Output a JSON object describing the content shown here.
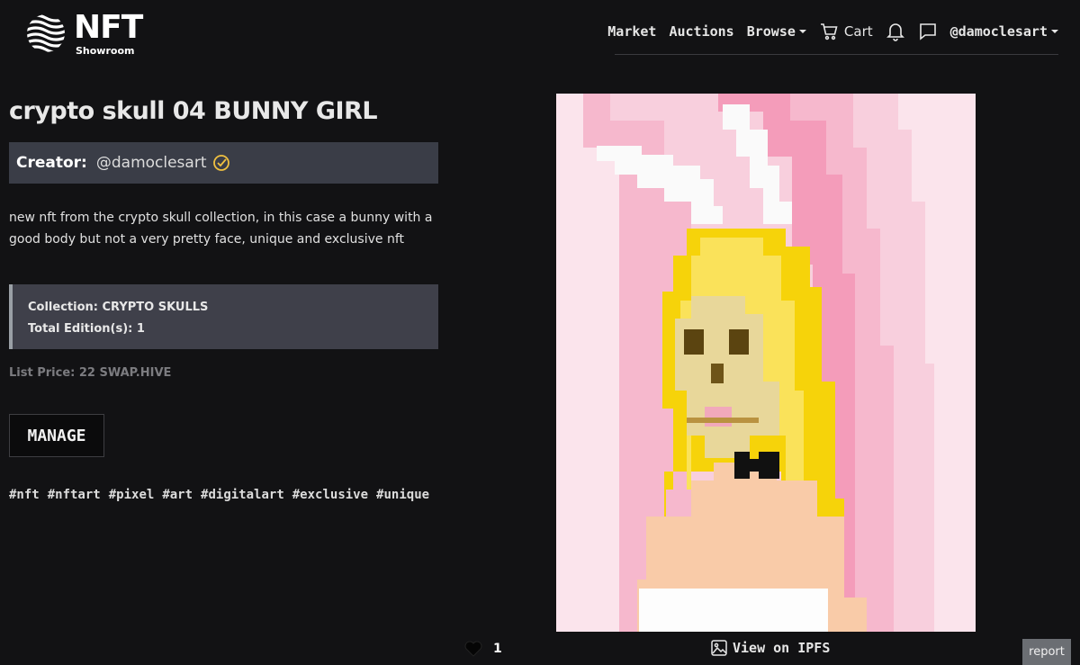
{
  "brand": {
    "name": "NFT",
    "tagline": "Showroom"
  },
  "nav": {
    "market": "Market",
    "auctions": "Auctions",
    "browse": "Browse",
    "cart": "Cart",
    "user": "@damoclesart",
    "icons": [
      "cart-icon",
      "bell-icon",
      "chat-icon"
    ]
  },
  "nft": {
    "title": "crypto skull 04 BUNNY GIRL",
    "creator_label": "Creator:",
    "creator_handle": "@damoclesart",
    "description": "new nft from the crypto skull collection, in this case a bunny with a good body but not a very pretty face, unique and exclusive nft",
    "collection": "Collection: CRYPTO SKULLS",
    "editions": "Total Edition(s): 1",
    "list_price": "List Price: 22 SWAP.HIVE",
    "manage_label": "MANAGE",
    "tags": [
      "#nft",
      "#nftart",
      "#pixel",
      "#art",
      "#digitalart",
      "#exclusive",
      "#unique"
    ],
    "likes": "1",
    "ipfs_label": "View on IPFS",
    "report_label": "report"
  },
  "colors": {
    "background": "#121214",
    "creator_bar": "#3a3d47",
    "collection_box": "#3f404a",
    "verified": "#f0c040",
    "art_pink": "#f490b4",
    "art_hair": "#f6d30a"
  }
}
